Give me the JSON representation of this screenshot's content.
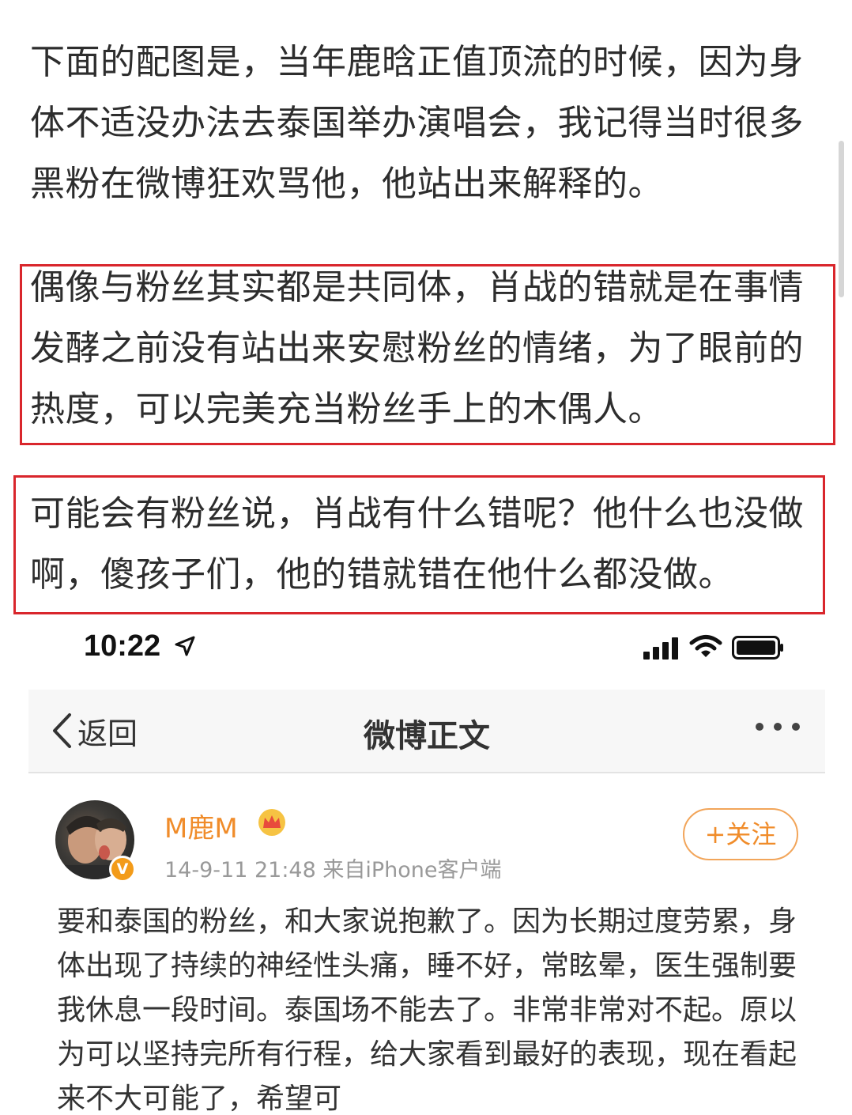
{
  "article": {
    "para1": "下面的配图是，当年鹿晗正值顶流的时候，因为身体不适没办法去泰国举办演唱会，我记得当时很多黑粉在微博狂欢骂他，他站出来解释的。",
    "para2": "偶像与粉丝其实都是共同体，肖战的错就是在事情发酵之前没有站出来安慰粉丝的情绪，为了眼前的热度，可以完美充当粉丝手上的木偶人。",
    "para3": "可能会有粉丝说，肖战有什么错呢？他什么也没做啊，傻孩子们，他的错就错在他什么都没做。",
    "highlight_color": "#d9262c"
  },
  "screenshot": {
    "status_bar": {
      "time": "10:22",
      "icons": [
        "location-arrow-icon",
        "signal-icon",
        "wifi-icon",
        "battery-icon"
      ]
    },
    "nav": {
      "back_label": "返回",
      "title": "微博正文",
      "more_icon": "more-dots-icon"
    },
    "post": {
      "username": "M鹿M",
      "verified_badge": "V",
      "meta": "14-9-11 21:48  来自iPhone客户端",
      "follow_label": "+关注",
      "accent_color": "#f08c2a",
      "body": "要和泰国的粉丝，和大家说抱歉了。因为长期过度劳累，身体出现了持续的神经性头痛，睡不好，常眩晕，医生强制要我休息一段时间。泰国场不能去了。非常非常对不起。原以为可以坚持完所有行程，给大家看到最好的表现，现在看起来不大可能了，希望可"
    }
  }
}
